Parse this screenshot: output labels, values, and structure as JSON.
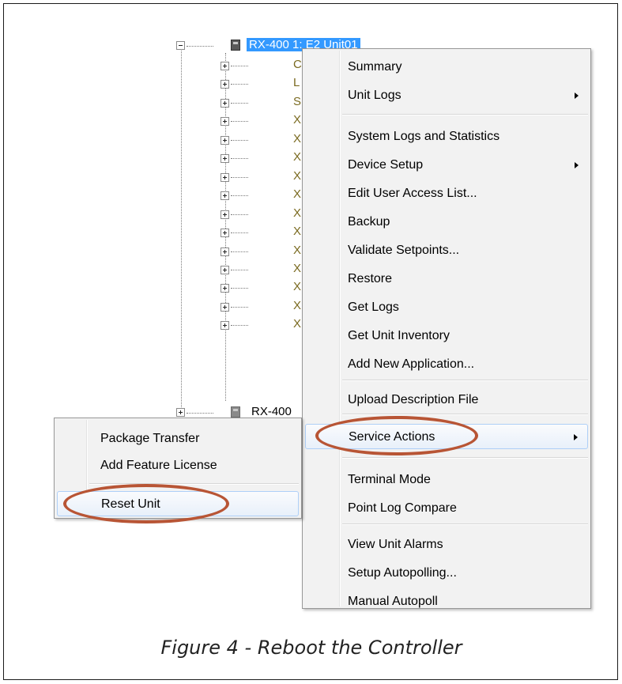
{
  "tree": {
    "selected_label": "RX-400 1: E2 Unit01",
    "sibling_label": "RX-400",
    "child_hints": [
      "C",
      "L",
      "S",
      "X",
      "X",
      "X",
      "X",
      "X",
      "X",
      "X",
      "X",
      "X",
      "X",
      "X",
      "X"
    ]
  },
  "context_menu": {
    "items": [
      {
        "label": "Summary",
        "submenu": false
      },
      {
        "label": "Unit Logs",
        "submenu": true
      },
      {
        "label": "System Logs and Statistics",
        "submenu": false
      },
      {
        "label": "Device Setup",
        "submenu": true
      },
      {
        "label": "Edit User Access List...",
        "submenu": false
      },
      {
        "label": "Backup",
        "submenu": false
      },
      {
        "label": "Validate Setpoints...",
        "submenu": false
      },
      {
        "label": "Restore",
        "submenu": false
      },
      {
        "label": "Get Logs",
        "submenu": false
      },
      {
        "label": "Get Unit Inventory",
        "submenu": false
      },
      {
        "label": "Add New Application...",
        "submenu": false
      },
      {
        "label": "Upload Description File",
        "submenu": false
      },
      {
        "label": "Service Actions",
        "submenu": true
      },
      {
        "label": "Terminal Mode",
        "submenu": false
      },
      {
        "label": "Point Log Compare",
        "submenu": false
      },
      {
        "label": "View Unit Alarms",
        "submenu": false
      },
      {
        "label": "Setup Autopolling...",
        "submenu": false
      },
      {
        "label": "Manual Autopoll",
        "submenu": false
      }
    ]
  },
  "service_submenu": {
    "items": [
      {
        "label": "Package Transfer"
      },
      {
        "label": "Add Feature License"
      },
      {
        "label": "Reset Unit"
      }
    ]
  },
  "caption": "Figure 4 - Reboot the Controller",
  "colors": {
    "selection": "#3399ff",
    "highlight_oval": "#b85535",
    "menu_background": "#f2f2f2"
  }
}
